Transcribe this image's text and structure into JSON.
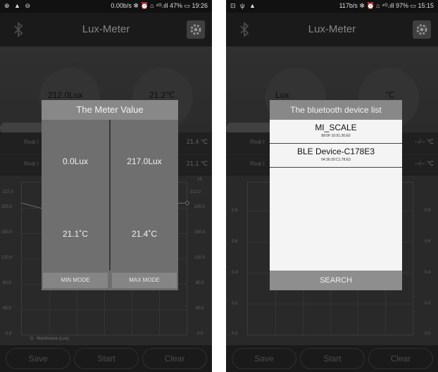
{
  "left": {
    "status_left": "⊕ ▲ ⊖",
    "status_right": "0.00b/s ✻ ⏰ ⌂ ⁴ᴳ.ıll 47% ▭ 19:26",
    "app_title": "Lux-Meter",
    "lux_big": "212.0Lux",
    "temp_big": "21.2℃",
    "real_row1_label": "Real I",
    "real_row1_value": "21.4 ℃",
    "real_row2_label": "Real I",
    "real_row2_value": "21.1 ℃",
    "y_ticks": [
      "200.0",
      "160.0",
      "120.0",
      "80.0",
      "40.0",
      "0.0"
    ],
    "right_top_tick": "15",
    "point_label_left": "217.0",
    "point_label_right": "212.0",
    "legend": "Illuminance (Lux)",
    "bottom": {
      "save": "Save",
      "start": "Start",
      "clear": "Clear"
    },
    "dialog": {
      "title": "The Meter Value",
      "min_lux": "0.0Lux",
      "max_lux": "217.0Lux",
      "min_temp": "21.1˚C",
      "max_temp": "21.4˚C",
      "min_mode": "MIN MODE",
      "max_mode": "MAX MODE"
    }
  },
  "right": {
    "status_left": "⊡ ψ ▲",
    "status_right": "117b/s ✻ ⏰ ⌂ ⁴ᴳ.ıll 97% ▭ 15:15",
    "app_title": "Lux-Meter",
    "lux_big": "Lux",
    "temp_big": "℃",
    "real_row1_label": "Real I",
    "real_row1_value": "--/-- ℃",
    "real_row2_label": "Real I",
    "real_row2_value": "--/-- ℃",
    "y_ticks": [
      "0.8",
      "0.6",
      "0.4",
      "0.2",
      "0.0"
    ],
    "bottom": {
      "save": "Save",
      "start": "Start",
      "clear": "Clear"
    },
    "dialog": {
      "title": "The bluetooth device list",
      "devices": [
        {
          "name": "MI_SCALE",
          "mac": "88:0F:10:91:36:E0"
        },
        {
          "name": "BLE Device-C178E3",
          "mac": "04:36:39:C1:78:E3"
        }
      ],
      "search": "SEARCH"
    }
  },
  "colors": {
    "background": "#3e3e3e",
    "dialog_header": "#888888",
    "dialog_body": "#6f6f6f",
    "list_body": "#f4f4f4"
  }
}
